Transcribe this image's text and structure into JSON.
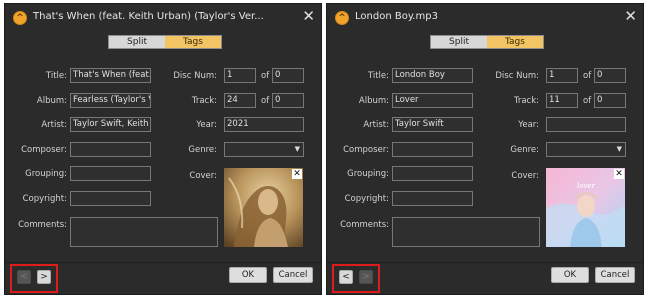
{
  "labels": {
    "title": "Title:",
    "album": "Album:",
    "artist": "Artist:",
    "composer": "Composer:",
    "grouping": "Grouping:",
    "copyright": "Copyright:",
    "comments": "Comments:",
    "disc_num": "Disc Num:",
    "track": "Track:",
    "year": "Year:",
    "genre": "Genre:",
    "cover": "Cover:",
    "of": "of"
  },
  "tabs": {
    "split": "Split",
    "tags": "Tags",
    "active": "Tags"
  },
  "buttons": {
    "ok": "OK",
    "cancel": "Cancel",
    "prev": "<",
    "next": ">"
  },
  "icons": {
    "app": "app-logo-icon",
    "close": "close-icon",
    "remove_cover": "remove-cover-icon",
    "dropdown": "chevron-down-icon"
  },
  "colors": {
    "tab_active": "#f2c464",
    "highlight": "#e01b1b",
    "dialog_bg": "#2b2b2b"
  },
  "left": {
    "window_title": "That's When (feat. Keith Urban) (Taylor's Ver...",
    "fields": {
      "title": "That's When (feat. Ke",
      "album": "Fearless (Taylor's Vers",
      "artist": "Taylor Swift, Keith Urb",
      "composer": "",
      "grouping": "",
      "copyright": "",
      "comments": "",
      "disc_num": "1",
      "disc_total": "0",
      "track": "24",
      "track_total": "0",
      "year": "2021",
      "genre": ""
    },
    "prev_enabled": false,
    "next_enabled": true
  },
  "right": {
    "window_title": "London Boy.mp3",
    "fields": {
      "title": "London Boy",
      "album": "Lover",
      "artist": "Taylor Swift",
      "composer": "",
      "grouping": "",
      "copyright": "",
      "comments": "",
      "disc_num": "1",
      "disc_total": "0",
      "track": "11",
      "track_total": "0",
      "year": "",
      "genre": ""
    },
    "prev_enabled": true,
    "next_enabled": false
  }
}
